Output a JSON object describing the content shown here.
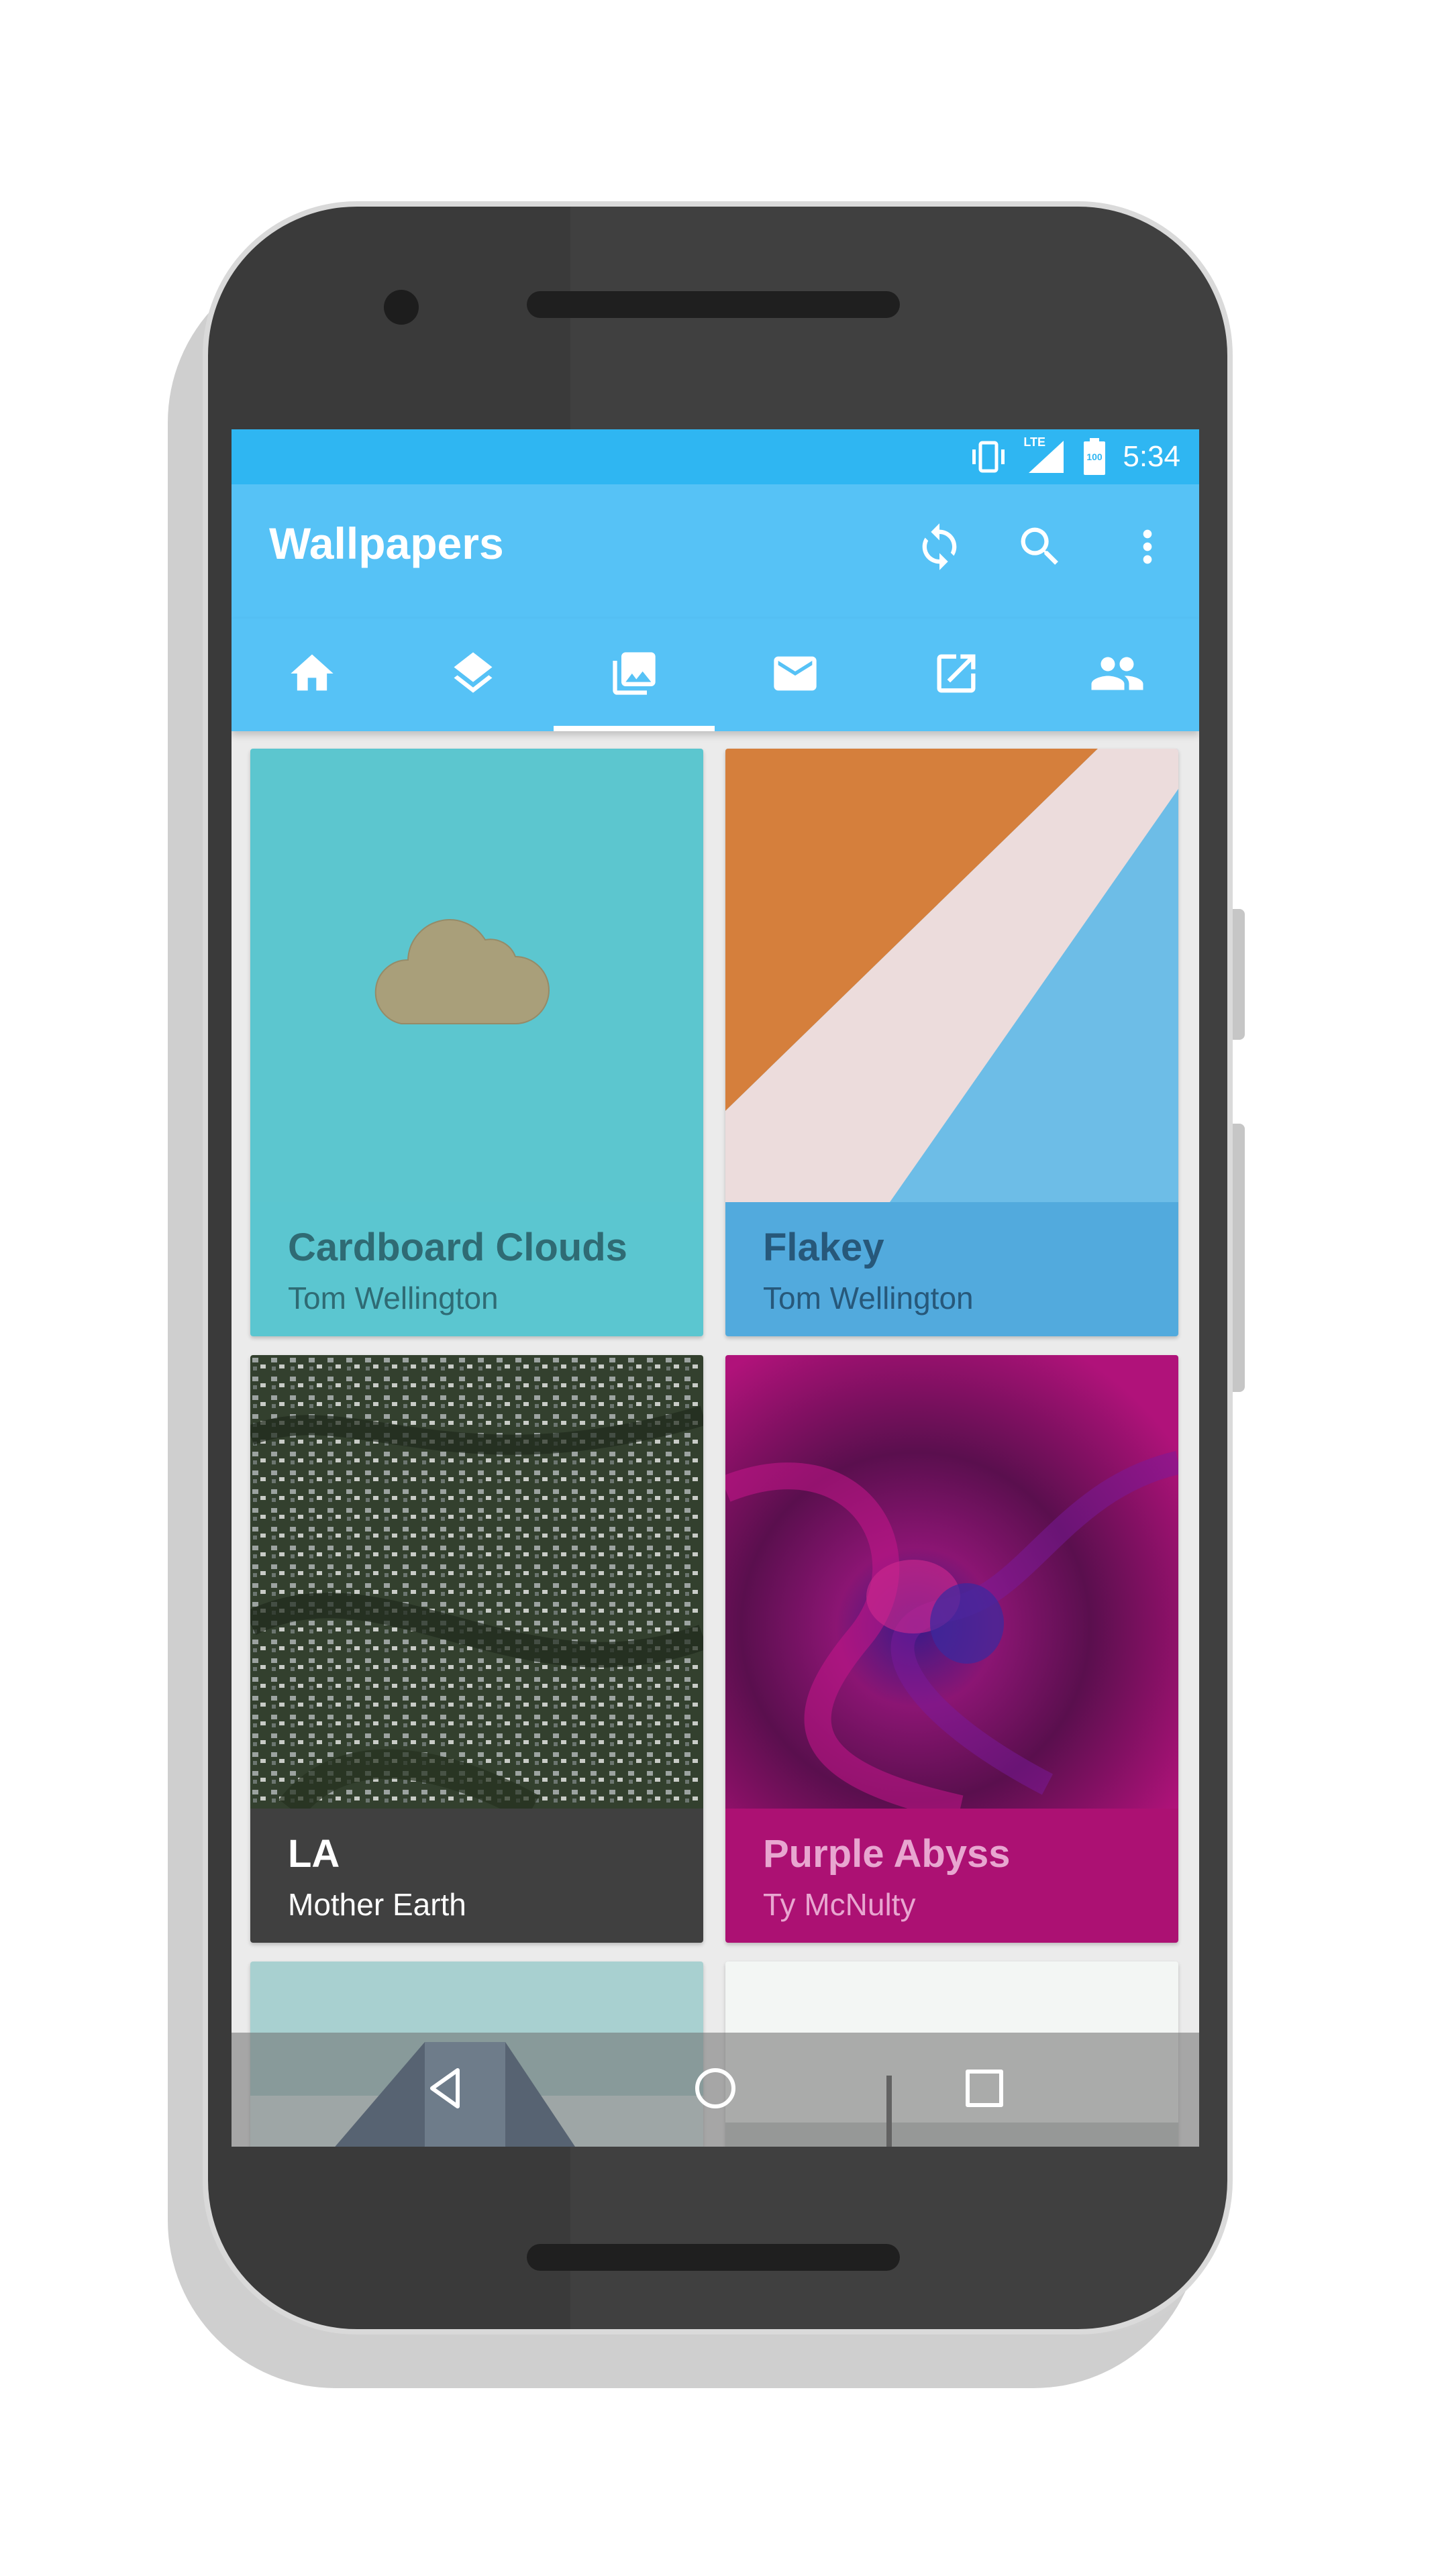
{
  "status_bar": {
    "network": "LTE",
    "battery": "100",
    "time": "5:34"
  },
  "app_bar": {
    "title": "Wallpapers",
    "actions": [
      "sync-icon",
      "search-icon",
      "more-vert-icon"
    ]
  },
  "tabs": [
    {
      "icon": "home-icon",
      "selected": false
    },
    {
      "icon": "layers-icon",
      "selected": false
    },
    {
      "icon": "wallpaper-icon",
      "selected": true
    },
    {
      "icon": "mail-icon",
      "selected": false
    },
    {
      "icon": "open-in-new-icon",
      "selected": false
    },
    {
      "icon": "people-icon",
      "selected": false
    }
  ],
  "wallpapers": [
    {
      "title": "Cardboard Clouds",
      "author": "Tom Wellington",
      "footer_color": "#5bc6d0",
      "text_color": "#2f6b74"
    },
    {
      "title": "Flakey",
      "author": "Tom Wellington",
      "footer_color": "#52aadd",
      "text_color": "#27587a"
    },
    {
      "title": "LA",
      "author": "Mother Earth",
      "footer_color": "#404040",
      "text_color": "#ffffff"
    },
    {
      "title": "Purple Abyss",
      "author": "Ty McNulty",
      "footer_color": "#ac1173",
      "text_color": "#e8a6d0"
    }
  ],
  "nav_bar": [
    "back-icon",
    "home-circle-icon",
    "recents-icon"
  ],
  "colors": {
    "status_bar": "#2fb6f2",
    "app_bar": "#56c2f6",
    "phone_body": "#3a3a3a"
  }
}
